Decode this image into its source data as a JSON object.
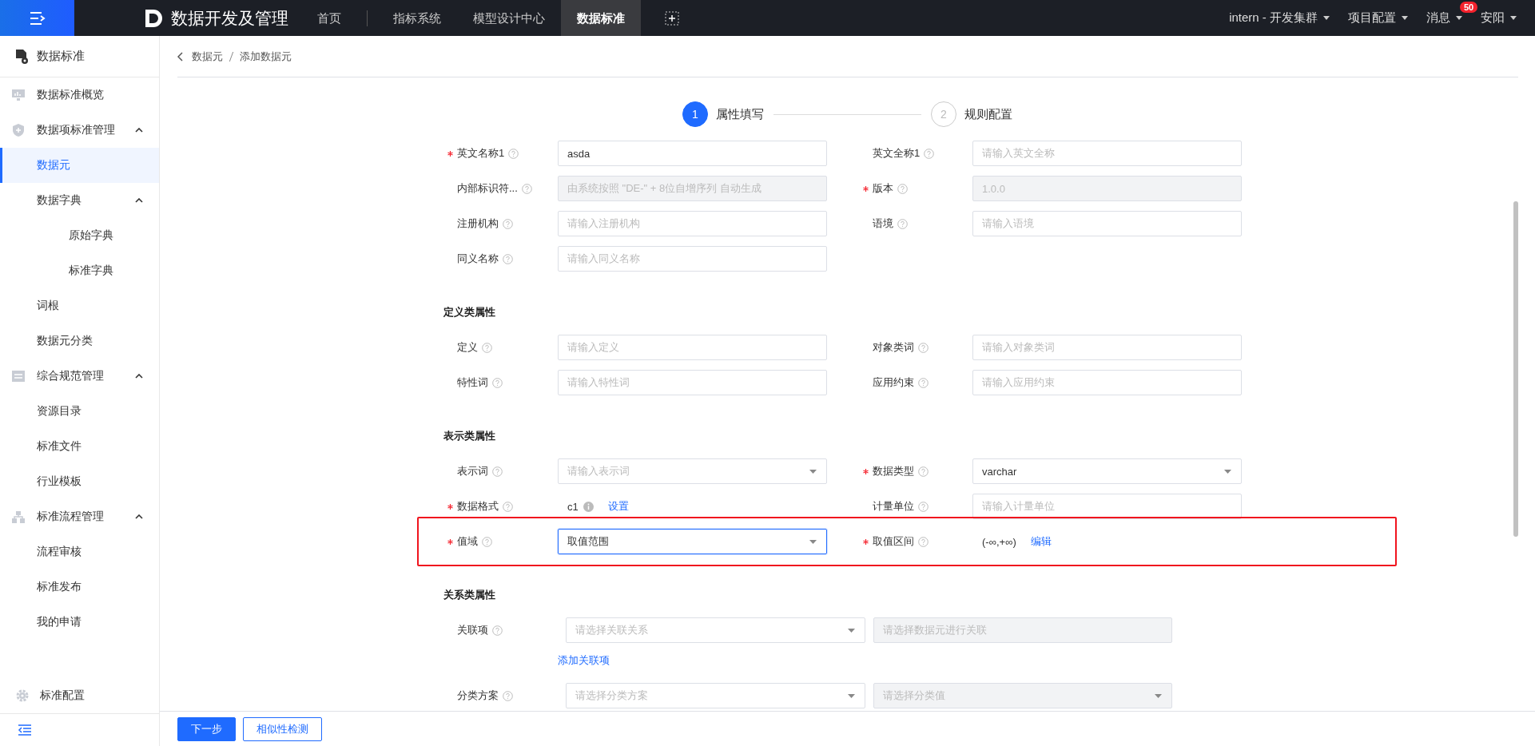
{
  "topbar": {
    "app_title": "数据开发及管理",
    "nav": [
      {
        "label": "首页",
        "selected": false
      },
      {
        "label": "指标系统",
        "selected": false
      },
      {
        "label": "模型设计中心",
        "selected": false
      },
      {
        "label": "数据标准",
        "selected": true
      }
    ],
    "menus": [
      {
        "label": "intern - 开发集群"
      },
      {
        "label": "项目配置"
      },
      {
        "label": "消息",
        "badge": "50"
      },
      {
        "label": "安阳"
      }
    ]
  },
  "sidebar": {
    "title": "数据标准",
    "items": [
      {
        "label": "数据标准概览",
        "selected": false
      },
      {
        "label": "数据项标准管理",
        "selected": false,
        "expanded": true,
        "children": [
          {
            "label": "数据元",
            "selected": true
          },
          {
            "label": "数据字典",
            "selected": false,
            "expanded": true,
            "children": [
              {
                "label": "原始字典",
                "selected": false
              },
              {
                "label": "标准字典",
                "selected": false
              }
            ]
          },
          {
            "label": "词根",
            "selected": false
          },
          {
            "label": "数据元分类",
            "selected": false
          }
        ]
      },
      {
        "label": "综合规范管理",
        "selected": false,
        "expanded": true,
        "children": [
          {
            "label": "资源目录",
            "selected": false
          },
          {
            "label": "标准文件",
            "selected": false
          },
          {
            "label": "行业模板",
            "selected": false
          }
        ]
      },
      {
        "label": "标准流程管理",
        "selected": false,
        "expanded": true,
        "children": [
          {
            "label": "流程审核",
            "selected": false
          },
          {
            "label": "标准发布",
            "selected": false
          },
          {
            "label": "我的申请",
            "selected": false
          }
        ]
      }
    ],
    "footer": "标准配置"
  },
  "breadcrumb": [
    "数据元",
    "添加数据元"
  ],
  "steps": [
    {
      "number": "1",
      "label": "属性填写",
      "selected": true
    },
    {
      "number": "2",
      "label": "规则配置",
      "selected": false
    }
  ],
  "form": {
    "sections": [
      {
        "rows": [
          {
            "kind": "fields",
            "highlighted": false,
            "fields": [
              {
                "label": "英文名称1",
                "required": true,
                "control": {
                  "kind": "input",
                  "value": "asda",
                  "disabled": false
                }
              },
              {
                "label": "英文全称1",
                "required": false,
                "control": {
                  "kind": "input",
                  "placeholder": "请输入英文全称",
                  "disabled": false
                }
              }
            ]
          },
          {
            "kind": "fields",
            "highlighted": false,
            "fields": [
              {
                "label": "内部标识符...",
                "required": false,
                "control": {
                  "kind": "input",
                  "placeholder": "由系统按照 \"DE-\" + 8位自增序列 自动生成",
                  "disabled": true
                }
              },
              {
                "label": "版本",
                "required": true,
                "control": {
                  "kind": "input",
                  "placeholder": "1.0.0",
                  "disabled": true
                }
              }
            ]
          },
          {
            "kind": "fields",
            "highlighted": false,
            "fields": [
              {
                "label": "注册机构",
                "required": false,
                "control": {
                  "kind": "input",
                  "placeholder": "请输入注册机构",
                  "disabled": false
                }
              },
              {
                "label": "语境",
                "required": false,
                "control": {
                  "kind": "input",
                  "placeholder": "请输入语境",
                  "disabled": false
                }
              }
            ]
          },
          {
            "kind": "fields",
            "highlighted": false,
            "fields": [
              {
                "label": "同义名称",
                "required": false,
                "control": {
                  "kind": "input",
                  "placeholder": "请输入同义名称",
                  "disabled": false
                }
              }
            ]
          }
        ]
      },
      {
        "title": "定义类属性",
        "rows": [
          {
            "kind": "fields",
            "highlighted": false,
            "fields": [
              {
                "label": "定义",
                "required": false,
                "control": {
                  "kind": "input",
                  "placeholder": "请输入定义",
                  "disabled": false
                }
              },
              {
                "label": "对象类词",
                "required": false,
                "control": {
                  "kind": "input",
                  "placeholder": "请输入对象类词",
                  "disabled": false
                }
              }
            ]
          },
          {
            "kind": "fields",
            "highlighted": false,
            "fields": [
              {
                "label": "特性词",
                "required": false,
                "control": {
                  "kind": "input",
                  "placeholder": "请输入特性词",
                  "disabled": false
                }
              },
              {
                "label": "应用约束",
                "required": false,
                "control": {
                  "kind": "input",
                  "placeholder": "请输入应用约束",
                  "disabled": false
                }
              }
            ]
          }
        ]
      },
      {
        "title": "表示类属性",
        "rows": [
          {
            "kind": "fields",
            "highlighted": false,
            "fields": [
              {
                "label": "表示词",
                "required": false,
                "control": {
                  "kind": "select",
                  "placeholder": "请输入表示词",
                  "disabled": false,
                  "focused": false
                }
              },
              {
                "label": "数据类型",
                "required": true,
                "control": {
                  "kind": "select",
                  "value": "varchar",
                  "disabled": false,
                  "focused": false
                }
              }
            ]
          },
          {
            "kind": "fields",
            "highlighted": false,
            "fields": [
              {
                "label": "数据格式",
                "required": true,
                "control": {
                  "kind": "text_link",
                  "text": "c1",
                  "info": true,
                  "link": "设置"
                }
              },
              {
                "label": "计量单位",
                "required": false,
                "control": {
                  "kind": "input",
                  "placeholder": "请输入计量单位",
                  "disabled": false
                }
              }
            ]
          },
          {
            "kind": "fields",
            "highlighted": true,
            "fields": [
              {
                "label": "值域",
                "required": true,
                "control": {
                  "kind": "select",
                  "value": "取值范围",
                  "disabled": false,
                  "focused": true
                }
              },
              {
                "label": "取值区间",
                "required": true,
                "control": {
                  "kind": "text_link",
                  "text": "(-∞,+∞)",
                  "info": false,
                  "link": "编辑"
                }
              }
            ]
          }
        ]
      },
      {
        "title": "关系类属性",
        "rows": [
          {
            "kind": "pair",
            "label": "关联项",
            "required": false,
            "controls": [
              {
                "kind": "select",
                "placeholder": "请选择关联关系",
                "disabled": false,
                "focused": false
              },
              {
                "kind": "input",
                "placeholder": "请选择数据元进行关联",
                "disabled": true
              }
            ]
          },
          {
            "kind": "link",
            "text": "添加关联项"
          },
          {
            "kind": "pair",
            "label": "分类方案",
            "required": false,
            "controls": [
              {
                "kind": "select",
                "placeholder": "请选择分类方案",
                "disabled": false,
                "focused": false
              },
              {
                "kind": "select",
                "placeholder": "请选择分类值",
                "disabled": true,
                "focused": false
              }
            ]
          }
        ]
      }
    ]
  },
  "actions": [
    {
      "label": "下一步",
      "kind": "primary"
    },
    {
      "label": "相似性检测",
      "kind": "default"
    }
  ]
}
